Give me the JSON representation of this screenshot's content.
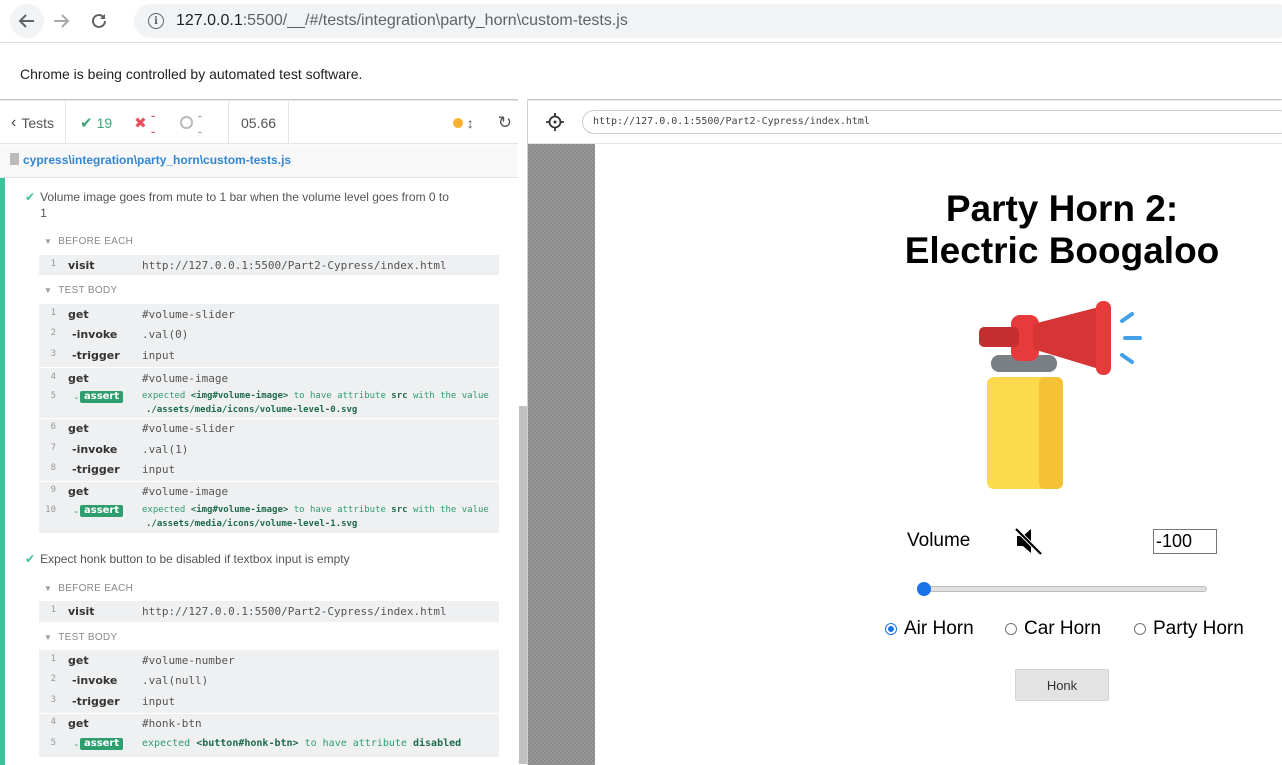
{
  "browser": {
    "url_host": "127.0.0.1",
    "url_rest": ":5500/__/#/tests/integration\\party_horn\\custom-tests.js",
    "infobar_text": "Chrome is being controlled by automated test software."
  },
  "reporter": {
    "tests_label": "Tests",
    "passed": "19",
    "failed": "--",
    "pending": "--",
    "duration": "05.66",
    "spec_path": "cypress\\integration\\party_horn\\custom-tests.js",
    "colors": {
      "passed": "#3aa576",
      "failed": "#e94f5f",
      "running": "#f7b12f",
      "bar": "#3cc399"
    }
  },
  "tests": [
    {
      "title_line1": "Volume image goes from mute to 1 bar when the volume level goes from 0 to",
      "title_line2": "1",
      "before_each_label": "BEFORE EACH",
      "before_each": [
        {
          "num": "1",
          "name": "visit",
          "message": "http://127.0.0.1:5500/Part2-Cypress/index.html"
        }
      ],
      "test_body_label": "TEST BODY",
      "body": [
        {
          "num": "1",
          "name": "get",
          "message": "#volume-slider"
        },
        {
          "num": "2",
          "name": "-invoke",
          "message": ".val(0)"
        },
        {
          "num": "3",
          "name": "-trigger",
          "message": "input"
        },
        {
          "num": "4",
          "name": "get",
          "message": "#volume-image"
        },
        {
          "num": "5",
          "name": "assert",
          "expected": "expected",
          "subject": "<img#volume-image>",
          "mid": "to have attribute",
          "attr": "src",
          "tail": "with the value",
          "value": "./assets/media/icons/volume-level-0.svg"
        },
        {
          "num": "6",
          "name": "get",
          "message": "#volume-slider"
        },
        {
          "num": "7",
          "name": "-invoke",
          "message": ".val(1)"
        },
        {
          "num": "8",
          "name": "-trigger",
          "message": "input"
        },
        {
          "num": "9",
          "name": "get",
          "message": "#volume-image"
        },
        {
          "num": "10",
          "name": "assert",
          "expected": "expected",
          "subject": "<img#volume-image>",
          "mid": "to have attribute",
          "attr": "src",
          "tail": "with the value",
          "value": "./assets/media/icons/volume-level-1.svg"
        }
      ]
    },
    {
      "title_line1": "Expect honk button to be disabled if textbox input is empty",
      "before_each_label": "BEFORE EACH",
      "before_each": [
        {
          "num": "1",
          "name": "visit",
          "message": "http://127.0.0.1:5500/Part2-Cypress/index.html"
        }
      ],
      "test_body_label": "TEST BODY",
      "body": [
        {
          "num": "1",
          "name": "get",
          "message": "#volume-number"
        },
        {
          "num": "2",
          "name": "-invoke",
          "message": ".val(null)"
        },
        {
          "num": "3",
          "name": "-trigger",
          "message": "input"
        },
        {
          "num": "4",
          "name": "get",
          "message": "#honk-btn"
        },
        {
          "num": "5",
          "name": "assert",
          "expected": "expected",
          "subject": "<button#honk-btn>",
          "mid": "to have attribute",
          "attr": "disabled"
        }
      ]
    }
  ],
  "aut": {
    "url": "http://127.0.0.1:5500/Part2-Cypress/index.html",
    "title_line1": "Party Horn 2:",
    "title_line2": "Electric Boogaloo",
    "volume_label": "Volume",
    "volume_value": "-100",
    "volume_slider_fraction": 0,
    "radio_options": [
      "Air Horn",
      "Car Horn",
      "Party Horn"
    ],
    "selected_radio": "Air Horn",
    "honk_label": "Honk",
    "icons": {
      "horn": "air-horn-image",
      "volume": "volume-muted-icon"
    }
  }
}
